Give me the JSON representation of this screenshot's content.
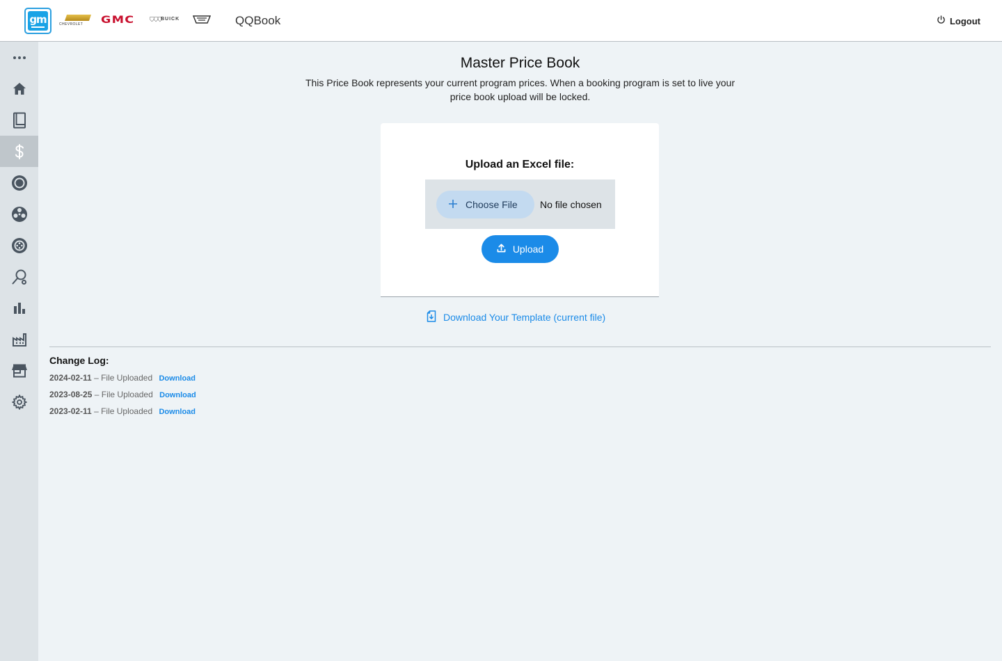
{
  "header": {
    "brands": {
      "gm": "gm",
      "chevrolet": "CHEVROLET",
      "gmc": "GMC",
      "buick": "BUICK"
    },
    "app_title": "QQBook",
    "logout_label": "Logout"
  },
  "sidebar": {
    "items": [
      {
        "icon": "more-icon"
      },
      {
        "icon": "home-icon"
      },
      {
        "icon": "book-icon"
      },
      {
        "icon": "dollar-icon",
        "active": true
      },
      {
        "icon": "target-icon"
      },
      {
        "icon": "wheel-icon"
      },
      {
        "icon": "tire-icon"
      },
      {
        "icon": "search-person-icon"
      },
      {
        "icon": "bar-chart-icon"
      },
      {
        "icon": "factory-icon"
      },
      {
        "icon": "store-icon"
      },
      {
        "icon": "gear-icon"
      }
    ]
  },
  "main": {
    "title": "Master Price Book",
    "description": "This Price Book represents your current program prices. When a booking program is set to live your price book upload will be locked.",
    "upload_card": {
      "label": "Upload an Excel file:",
      "choose_file_label": "Choose File",
      "no_file_text": "No file chosen",
      "upload_label": "Upload"
    },
    "template_link": "Download Your Template (current file)",
    "change_log": {
      "title": "Change Log:",
      "entries": [
        {
          "date": "2024-02-11",
          "text": " – File Uploaded",
          "action": "Download"
        },
        {
          "date": "2023-08-25",
          "text": " – File Uploaded",
          "action": "Download"
        },
        {
          "date": "2023-02-11",
          "text": " – File Uploaded",
          "action": "Download"
        }
      ]
    }
  },
  "colors": {
    "accent": "#1b8be8",
    "sidebar_bg": "#dde3e7",
    "page_bg": "#eef3f6"
  }
}
